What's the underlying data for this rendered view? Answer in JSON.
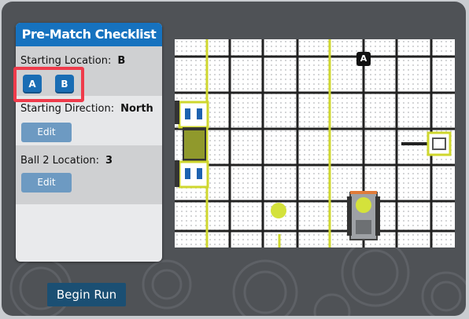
{
  "panel": {
    "title": "Pre-Match Checklist",
    "starting_location": {
      "label": "Starting Location:",
      "value": "B",
      "options": [
        "A",
        "B"
      ]
    },
    "starting_direction": {
      "label": "Starting Direction:",
      "value": "North",
      "edit_label": "Edit"
    },
    "ball_location": {
      "label": "Ball 2 Location:",
      "value": "3",
      "edit_label": "Edit"
    }
  },
  "actions": {
    "begin_run": "Begin Run"
  },
  "field": {
    "goal_marker": "A"
  },
  "colors": {
    "accent_blue": "#1672bf",
    "highlight": "#ef3b4b",
    "field_yellow": "#d8e33a",
    "ball": "#d4e23b"
  }
}
